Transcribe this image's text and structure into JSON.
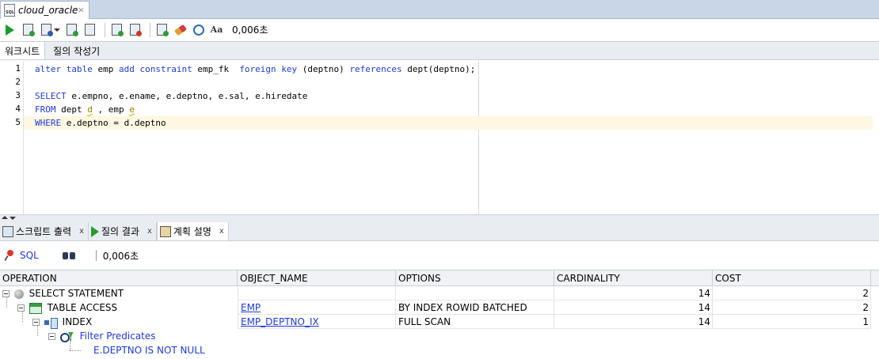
{
  "document_tab": {
    "label": "cloud_oracle",
    "close": "×"
  },
  "toolbar": {
    "elapsed": "0,006초"
  },
  "worksheet_tabs": [
    {
      "label": "워크시트"
    },
    {
      "label": "질의 작성기"
    }
  ],
  "editor": {
    "line_numbers": [
      "1",
      "2",
      "3",
      "4",
      "5"
    ],
    "lines": [
      {
        "segments": [
          {
            "t": "alter table ",
            "c": "kw"
          },
          {
            "t": "emp ",
            "c": "plain"
          },
          {
            "t": "add constraint ",
            "c": "kw"
          },
          {
            "t": "emp_fk  ",
            "c": "plain"
          },
          {
            "t": "foreign key ",
            "c": "kw"
          },
          {
            "t": "(deptno) ",
            "c": "plain"
          },
          {
            "t": "references ",
            "c": "kw"
          },
          {
            "t": "dept(deptno);",
            "c": "plain"
          }
        ]
      },
      {
        "segments": []
      },
      {
        "segments": [
          {
            "t": "SELECT ",
            "c": "kw"
          },
          {
            "t": "e.empno, e.ename, e.deptno, e.sal, e.hiredate",
            "c": "plain"
          }
        ]
      },
      {
        "segments": [
          {
            "t": "FROM ",
            "c": "kw"
          },
          {
            "t": "dept ",
            "c": "plain"
          },
          {
            "t": "d",
            "c": "dlink"
          },
          {
            "t": " , emp ",
            "c": "plain"
          },
          {
            "t": "e",
            "c": "dlink"
          }
        ]
      },
      {
        "segments": [
          {
            "t": "WHERE ",
            "c": "kw"
          },
          {
            "t": "e.deptno = d.deptno",
            "c": "plain"
          }
        ]
      }
    ],
    "current_line": 5
  },
  "result_tabs": [
    {
      "label": "스크립트 출력",
      "close": "x"
    },
    {
      "label": "질의 결과",
      "close": "x"
    },
    {
      "label": "계획 설명",
      "close": "x"
    }
  ],
  "result_toolbar": {
    "sql_label": "SQL",
    "elapsed": "0,006초"
  },
  "plan": {
    "columns": [
      "OPERATION",
      "OBJECT_NAME",
      "OPTIONS",
      "CARDINALITY",
      "COST"
    ],
    "rows": [
      {
        "operation": "SELECT STATEMENT",
        "object": "",
        "options": "",
        "cardinality": "14",
        "cost": "2"
      },
      {
        "operation": "TABLE ACCESS",
        "object": "EMP",
        "options": "BY INDEX ROWID BATCHED",
        "cardinality": "14",
        "cost": "2"
      },
      {
        "operation": "INDEX",
        "object": "EMP_DEPTNO_IX",
        "options": "FULL SCAN",
        "cardinality": "14",
        "cost": "1"
      },
      {
        "operation": "Filter Predicates",
        "object": "",
        "options": "",
        "cardinality": "",
        "cost": ""
      },
      {
        "operation": "E.DEPTNO IS NOT NULL",
        "object": "",
        "options": "",
        "cardinality": "",
        "cost": ""
      }
    ]
  },
  "colors": {
    "keyword": "#1f3ad8",
    "current_line": "#fdf8e2",
    "header_bg": "#c9d6e8"
  }
}
